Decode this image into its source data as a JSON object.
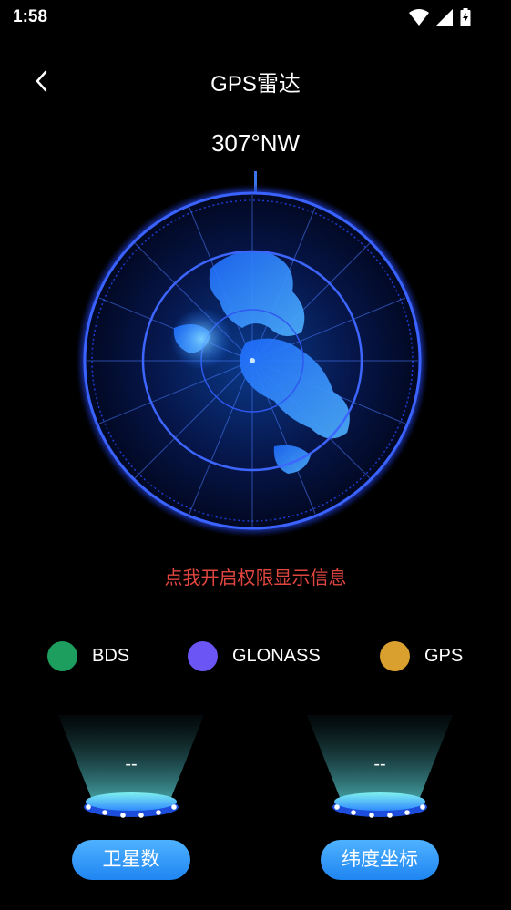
{
  "status_bar": {
    "time": "1:58",
    "icons": [
      "wifi-icon",
      "signal-icon",
      "battery-charging-icon"
    ]
  },
  "nav": {
    "back_icon": "chevron-left-icon",
    "title": "GPS雷达"
  },
  "compass": {
    "heading": "307°NW"
  },
  "radar": {
    "image": "globe-radar"
  },
  "message": {
    "permission": "点我开启权限显示信息"
  },
  "legend": {
    "items": [
      {
        "label": "BDS",
        "color": "#1e9e5e"
      },
      {
        "label": "GLONASS",
        "color": "#6b55f5"
      },
      {
        "label": "GPS",
        "color": "#d9a02f"
      }
    ]
  },
  "stats": {
    "satellite_count": {
      "value": "--",
      "label": "卫星数"
    },
    "latitude": {
      "value": "--",
      "label": "纬度坐标"
    }
  },
  "colors": {
    "background": "#000000",
    "radar_ring": "#2f5cff",
    "message": "#e0463f",
    "pill": "#1f86f2"
  }
}
